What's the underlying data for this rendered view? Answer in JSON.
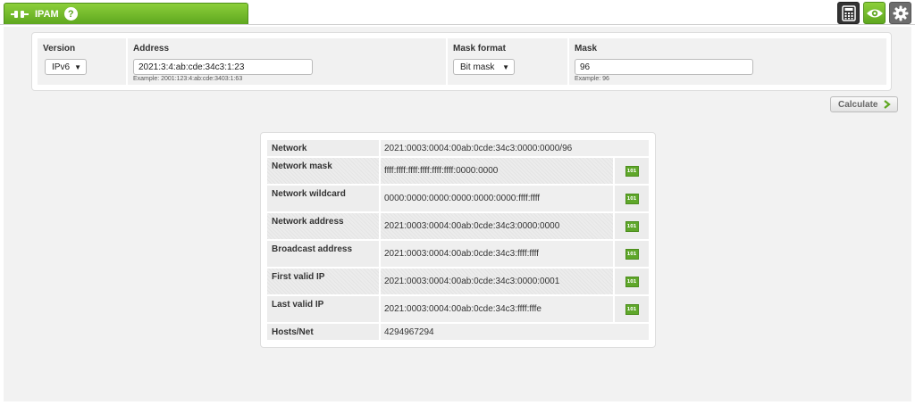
{
  "header": {
    "tab_title": "IPAM",
    "help_glyph": "?",
    "icons": [
      "plug-icon",
      "help-icon",
      "calculator-icon",
      "eye-icon",
      "gear-icon"
    ]
  },
  "form": {
    "version": {
      "label": "Version",
      "value": "IPv6"
    },
    "address": {
      "label": "Address",
      "value": "2021:3:4:ab:cde:34c3:1:23",
      "example": "Example: 2001:123:4:ab:cde:3403:1:63"
    },
    "mask_format": {
      "label": "Mask format",
      "value": "Bit mask"
    },
    "mask": {
      "label": "Mask",
      "value": "96",
      "example": "Example: 96"
    }
  },
  "calculate_label": "Calculate",
  "results": [
    {
      "label": "Network",
      "value": "2021:0003:0004:00ab:0cde:34c3:0000:0000/96",
      "has_button": false
    },
    {
      "label": "Network mask",
      "value": "ffff:ffff:ffff:ffff:ffff:ffff:0000:0000",
      "has_button": true
    },
    {
      "label": "Network wildcard",
      "value": "0000:0000:0000:0000:0000:0000:ffff:ffff",
      "has_button": true
    },
    {
      "label": "Network address",
      "value": "2021:0003:0004:00ab:0cde:34c3:0000:0000",
      "has_button": true
    },
    {
      "label": "Broadcast address",
      "value": "2021:0003:0004:00ab:0cde:34c3:ffff:ffff",
      "has_button": true
    },
    {
      "label": "First valid IP",
      "value": "2021:0003:0004:00ab:0cde:34c3:0000:0001",
      "has_button": true
    },
    {
      "label": "Last valid IP",
      "value": "2021:0003:0004:00ab:0cde:34c3:ffff:fffe",
      "has_button": true
    },
    {
      "label": "Hosts/Net",
      "value": "4294967294",
      "has_button": false
    }
  ],
  "binary_button_label": "101",
  "colors": {
    "accent_green": "#5ea71f",
    "panel_bg": "#f2f2f2"
  }
}
